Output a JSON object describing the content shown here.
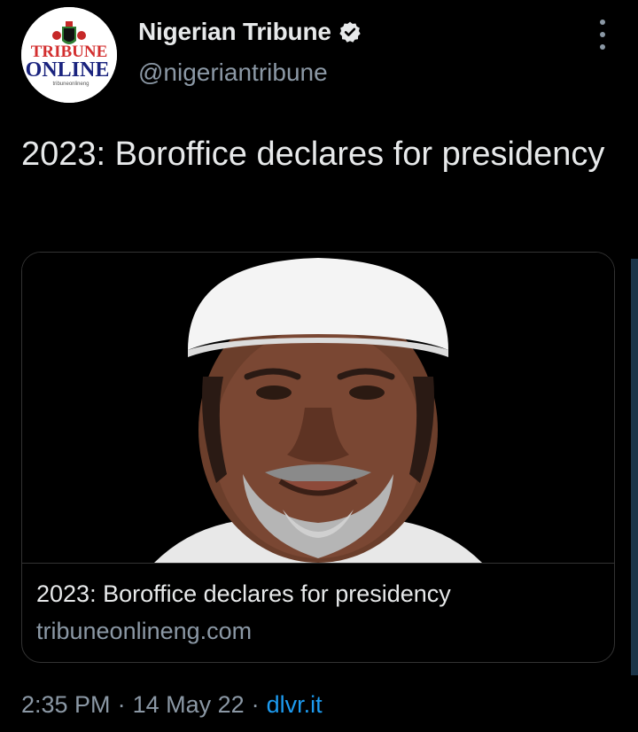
{
  "author": {
    "display_name": "Nigerian Tribune",
    "handle": "@nigeriantribune",
    "avatar_logo_text": [
      "TRIBUNE",
      "ONLINE",
      "tribuneonlineng"
    ],
    "verified": true
  },
  "tweet": {
    "text": "2023: Boroffice declares for presidency"
  },
  "link_card": {
    "title": "2023: Boroffice declares for presidency",
    "domain": "tribuneonlineng.com"
  },
  "meta": {
    "time": "2:35 PM",
    "sep1": "·",
    "date": "14 May 22",
    "sep2": "·",
    "source": "dlvr.it"
  },
  "colors": {
    "background": "#000000",
    "text_primary": "#e7e9ea",
    "text_secondary": "#8b98a5",
    "link": "#1d9bf0",
    "border": "#333333"
  },
  "icons": [
    "more-options-icon",
    "verified-badge-icon"
  ]
}
